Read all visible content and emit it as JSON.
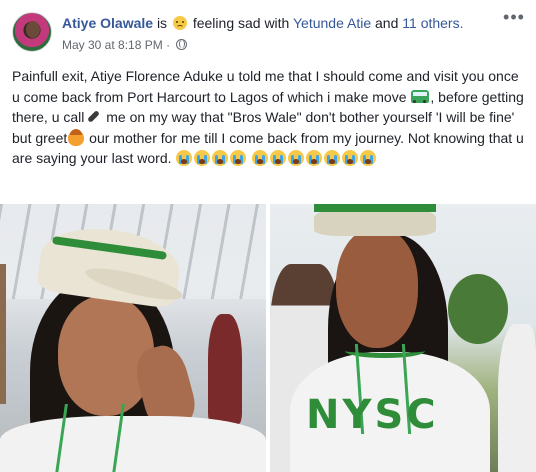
{
  "post": {
    "author": "Atiye Olawale",
    "verb_is": "is",
    "feeling": "feeling sad with",
    "tagged_person": "Yetunde Atie",
    "and_word": "and",
    "others": "11 others.",
    "timestamp": "May 30 at 8:18 PM",
    "separator": "·",
    "privacy_icon": "globe-icon",
    "more_icon": "more-dots-icon"
  },
  "body": {
    "seg1": "Painfull exit, Atiye Florence Aduke u told me that I should come and visit you once u come back from Port Harcourt to Lagos of which i make move",
    "seg2": ", before getting there, u call",
    "seg3": " me on my way that \"Bros Wale\" don't bother yourself 'I will be fine' but greet",
    "seg4": " our mother for me till I come back from my journey. Not knowing that u are saying your last word.",
    "emojis": [
      "bus-emoji",
      "phone-emoji",
      "greeting-emoji",
      "crying-emoji"
    ]
  },
  "photos": [
    {
      "badge": ""
    },
    {
      "badge": "NYSC"
    }
  ],
  "colors": {
    "link": "#365899",
    "text": "#1d2129",
    "meta": "#616770",
    "nysc_green": "#2f8d3a"
  }
}
